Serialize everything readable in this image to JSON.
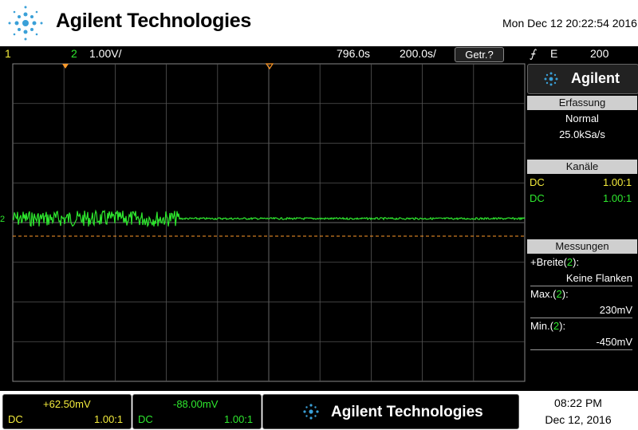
{
  "header": {
    "brand": "Agilent Technologies",
    "datetime": "Mon Dec 12 20:22:54 2016"
  },
  "statusbar": {
    "ch1_num": "1",
    "ch2_num": "2",
    "ch2_scale": "1.00V/",
    "delay": "796.0s",
    "timebase": "200.0s/",
    "run_state": "Getr.?",
    "trigger_mode": "E",
    "trigger_level": "200"
  },
  "panel": {
    "brand": "Agilent",
    "acquisition": {
      "heading": "Erfassung",
      "mode": "Normal",
      "rate": "25.0kSa/s"
    },
    "channels": {
      "heading": "Kanäle",
      "rows": [
        {
          "coupling": "DC",
          "probe": "1.00:1",
          "color": "#f4ec3c"
        },
        {
          "coupling": "DC",
          "probe": "1.00:1",
          "color": "#2ee82e"
        }
      ]
    },
    "measurements": {
      "heading": "Messungen",
      "items": [
        {
          "label": "+Breite",
          "ch": "2",
          "value": "Keine Flanken"
        },
        {
          "label": "Max.",
          "ch": "2",
          "value": "230mV"
        },
        {
          "label": "Min.",
          "ch": "2",
          "value": "-450mV"
        }
      ]
    }
  },
  "bottom": {
    "ch1": {
      "offset": "+62.50mV",
      "coupling": "DC",
      "probe": "1.00:1"
    },
    "ch2": {
      "offset": "-88.00mV",
      "coupling": "DC",
      "probe": "1.00:1"
    },
    "brand": "Agilent Technologies",
    "time": "08:22 PM",
    "date": "Dec 12, 2016"
  },
  "colors": {
    "ch1": "#f4ec3c",
    "ch2": "#2ee82e",
    "trigger": "#ff9a2a",
    "grid": "#555555"
  }
}
